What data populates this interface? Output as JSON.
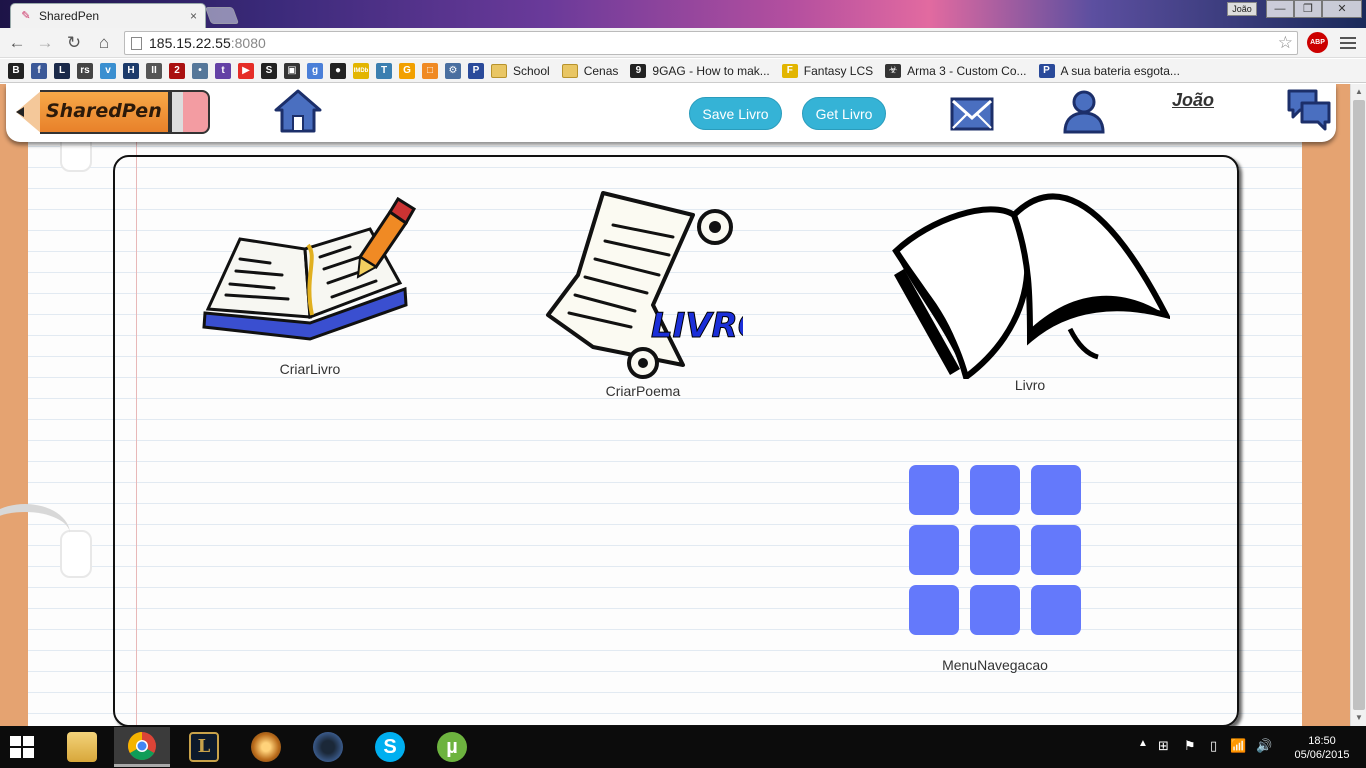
{
  "browser": {
    "tab_title": "SharedPen",
    "tab_close": "×",
    "profile_name": "João",
    "window_controls": {
      "minimize": "—",
      "restore": "❐",
      "close": "✕"
    },
    "nav": {
      "back": "←",
      "forward": "→",
      "reload": "↻",
      "home": "⌂"
    },
    "url_host": "185.15.22.55",
    "url_port": ":8080",
    "bookmark_star": "☆",
    "adblock_label": "ABP",
    "bookmarks_icons": [
      {
        "glyph": "B",
        "color": "#222222"
      },
      {
        "glyph": "f",
        "color": "#3b5998"
      },
      {
        "glyph": "L",
        "color": "#1b2a4a"
      },
      {
        "glyph": "rs",
        "color": "#444444"
      },
      {
        "glyph": "v",
        "color": "#3a8fd0"
      },
      {
        "glyph": "H",
        "color": "#1c3a6a"
      },
      {
        "glyph": "II",
        "color": "#555555"
      },
      {
        "glyph": "2",
        "color": "#aa1111"
      },
      {
        "glyph": "•",
        "color": "#557799"
      },
      {
        "glyph": "t",
        "color": "#6441a5"
      },
      {
        "glyph": "▶",
        "color": "#e52d27"
      },
      {
        "glyph": "S",
        "color": "#222222"
      },
      {
        "glyph": "▣",
        "color": "#333333"
      },
      {
        "glyph": "g",
        "color": "#4a7fd8"
      },
      {
        "glyph": "●",
        "color": "#222222"
      },
      {
        "glyph": "IMDb",
        "color": "#e3b500"
      },
      {
        "glyph": "T",
        "color": "#3b7fb0"
      },
      {
        "glyph": "G",
        "color": "#f2a000"
      },
      {
        "glyph": "□",
        "color": "#f08a24"
      },
      {
        "glyph": "⚙",
        "color": "#4a6fa0"
      },
      {
        "glyph": "P",
        "color": "#2a4a9a"
      }
    ],
    "bookmarks_named": [
      {
        "label": "School",
        "kind": "folder"
      },
      {
        "label": "Cenas",
        "kind": "folder"
      },
      {
        "label": "9GAG - How to mak...",
        "kind": "site",
        "icon": "9",
        "color": "#222222"
      },
      {
        "label": "Fantasy LCS",
        "kind": "site",
        "icon": "F",
        "color": "#e2b500"
      },
      {
        "label": "Arma 3 - Custom Co...",
        "kind": "site",
        "icon": "☣",
        "color": "#333333"
      },
      {
        "label": "A sua bateria esgota...",
        "kind": "site",
        "icon": "P",
        "color": "#2a4a9a"
      }
    ]
  },
  "site": {
    "logo_text": "SharedPen",
    "buttons": {
      "save": "Save Livro",
      "get": "Get Livro"
    },
    "user_name": "João",
    "tiles": [
      {
        "name": "criar-livro",
        "label": "CriarLivro"
      },
      {
        "name": "criar-poema",
        "label": "CriarPoema",
        "overlay": "LIVRO"
      },
      {
        "name": "livro",
        "label": "Livro"
      },
      {
        "name": "menu-navegacao",
        "label": "MenuNavegacao"
      }
    ]
  },
  "taskbar": {
    "apps": [
      "file-explorer",
      "chrome",
      "league-of-legends",
      "hearthstone",
      "steam",
      "skype",
      "utorrent"
    ],
    "time": "18:50",
    "date": "05/06/2015"
  }
}
